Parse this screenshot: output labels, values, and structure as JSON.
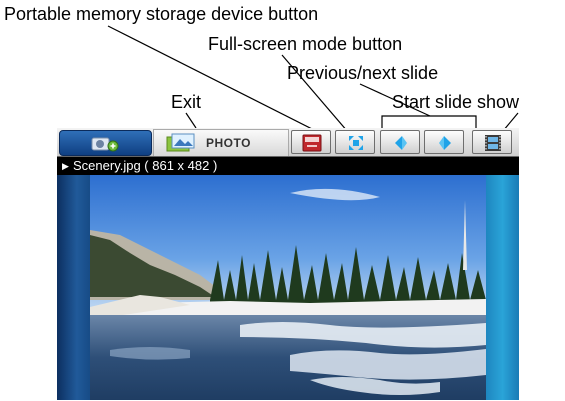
{
  "callouts": {
    "portable": "Portable memory storage device button",
    "fullscreen": "Full-screen mode button",
    "prevnext": "Previous/next slide",
    "exit": "Exit",
    "start": "Start slide show"
  },
  "toolbar": {
    "photo_tab_label": "PHOTO"
  },
  "viewer": {
    "file_info": "Scenery.jpg ( 861 x 482 )"
  },
  "icons": {
    "home": "home-device-icon",
    "photo": "photo-folder-icon",
    "memory": "memory-card-icon",
    "fullscreen": "expand-arrows-icon",
    "prev": "diamond-left-icon",
    "next": "diamond-right-icon",
    "slideshow": "film-strip-icon"
  },
  "colors": {
    "toolbar_blue": "#1a4f96",
    "button_accent": "#1fa3e8",
    "memory_red": "#c0282d"
  }
}
